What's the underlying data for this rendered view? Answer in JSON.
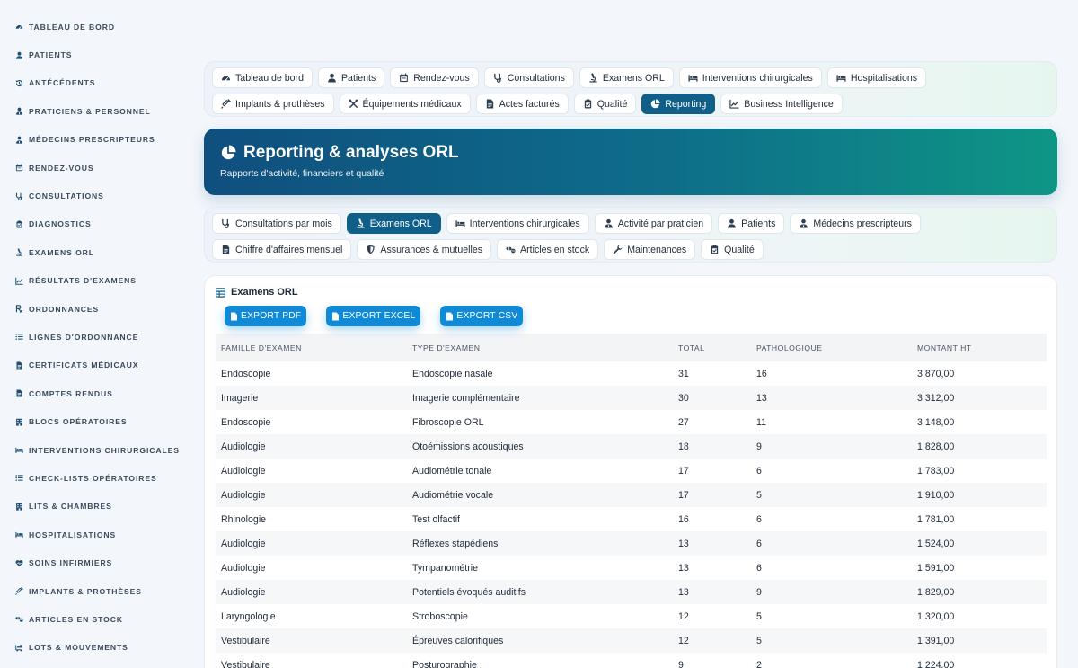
{
  "sidebar": {
    "items": [
      {
        "label": "Tableau de bord",
        "icon": "dashboard-icon"
      },
      {
        "label": "Patients",
        "icon": "user-icon"
      },
      {
        "label": "Antécédents",
        "icon": "history-icon"
      },
      {
        "label": "Praticiens & personnel",
        "icon": "doctor-icon"
      },
      {
        "label": "Médecins prescripteurs",
        "icon": "doctor-icon"
      },
      {
        "label": "Rendez-vous",
        "icon": "calendar-icon"
      },
      {
        "label": "Consultations",
        "icon": "stethoscope-icon"
      },
      {
        "label": "Diagnostics",
        "icon": "clipboard-icon"
      },
      {
        "label": "Examens ORL",
        "icon": "microscope-icon"
      },
      {
        "label": "Résultats d'examens",
        "icon": "chart-line-icon"
      },
      {
        "label": "Ordonnances",
        "icon": "prescription-icon"
      },
      {
        "label": "Lignes d'ordonnance",
        "icon": "list-icon"
      },
      {
        "label": "Certificats médicaux",
        "icon": "file-icon"
      },
      {
        "label": "Comptes rendus",
        "icon": "file-icon"
      },
      {
        "label": "Blocs opératoires",
        "icon": "building-icon"
      },
      {
        "label": "Interventions chirurgicales",
        "icon": "bed-icon"
      },
      {
        "label": "Check-lists opératoires",
        "icon": "list-icon"
      },
      {
        "label": "Lits & chambres",
        "icon": "building-icon"
      },
      {
        "label": "Hospitalisations",
        "icon": "bed-icon"
      },
      {
        "label": "Soins infirmiers",
        "icon": "heart-icon"
      },
      {
        "label": "Implants & prothèses",
        "icon": "syringe-icon"
      },
      {
        "label": "Articles en stock",
        "icon": "pills-icon"
      },
      {
        "label": "Lots & mouvements",
        "icon": "truck-icon"
      },
      {
        "label": "Équipements médicaux",
        "icon": "tools-icon"
      }
    ]
  },
  "top_nav": {
    "items": [
      {
        "label": "Tableau de bord",
        "icon": "dashboard-icon",
        "active": false
      },
      {
        "label": "Patients",
        "icon": "user-icon",
        "active": false
      },
      {
        "label": "Rendez-vous",
        "icon": "calendar-icon",
        "active": false
      },
      {
        "label": "Consultations",
        "icon": "stethoscope-icon",
        "active": false
      },
      {
        "label": "Examens ORL",
        "icon": "microscope-icon",
        "active": false
      },
      {
        "label": "Interventions chirurgicales",
        "icon": "bed-icon",
        "active": false
      },
      {
        "label": "Hospitalisations",
        "icon": "bed-icon",
        "active": false
      },
      {
        "label": "Implants & prothèses",
        "icon": "syringe-icon",
        "active": false
      },
      {
        "label": "Équipements médicaux",
        "icon": "tools-icon",
        "active": false
      },
      {
        "label": "Actes facturés",
        "icon": "file-icon",
        "active": false
      },
      {
        "label": "Qualité",
        "icon": "clipboard-icon",
        "active": false
      },
      {
        "label": "Reporting",
        "icon": "pie-chart-icon",
        "active": true
      },
      {
        "label": "Business Intelligence",
        "icon": "chart-line-icon",
        "active": false
      }
    ]
  },
  "hero": {
    "title": "Reporting & analyses ORL",
    "subtitle": "Rapports d'activité, financiers et qualité",
    "icon": "pie-chart-icon"
  },
  "sub_nav": {
    "items": [
      {
        "label": "Consultations par mois",
        "icon": "stethoscope-icon",
        "active": false
      },
      {
        "label": "Examens ORL",
        "icon": "microscope-icon",
        "active": true
      },
      {
        "label": "Interventions chirurgicales",
        "icon": "bed-icon",
        "active": false
      },
      {
        "label": "Activité par praticien",
        "icon": "doctor-icon",
        "active": false
      },
      {
        "label": "Patients",
        "icon": "user-icon",
        "active": false
      },
      {
        "label": "Médecins prescripteurs",
        "icon": "doctor-icon",
        "active": false
      },
      {
        "label": "Chiffre d'affaires mensuel",
        "icon": "file-icon",
        "active": false
      },
      {
        "label": "Assurances & mutuelles",
        "icon": "shield-icon",
        "active": false
      },
      {
        "label": "Articles en stock",
        "icon": "pills-icon",
        "active": false
      },
      {
        "label": "Maintenances",
        "icon": "wrench-icon",
        "active": false
      },
      {
        "label": "Qualité",
        "icon": "clipboard-icon",
        "active": false
      }
    ]
  },
  "card": {
    "title": "Examens ORL",
    "export_pdf": "EXPORT PDF",
    "export_excel": "EXPORT EXCEL",
    "export_csv": "EXPORT CSV",
    "columns": [
      "FAMILLE D'EXAMEN",
      "TYPE D'EXAMEN",
      "TOTAL",
      "PATHOLOGIQUE",
      "MONTANT HT"
    ],
    "rows": [
      [
        "Endoscopie",
        "Endoscopie nasale",
        "31",
        "16",
        "3 870,00"
      ],
      [
        "Imagerie",
        "Imagerie complémentaire",
        "30",
        "13",
        "3 312,00"
      ],
      [
        "Endoscopie",
        "Fibroscopie ORL",
        "27",
        "11",
        "3 148,00"
      ],
      [
        "Audiologie",
        "Otoémissions acoustiques",
        "18",
        "9",
        "1 828,00"
      ],
      [
        "Audiologie",
        "Audiométrie tonale",
        "17",
        "6",
        "1 783,00"
      ],
      [
        "Audiologie",
        "Audiométrie vocale",
        "17",
        "5",
        "1 910,00"
      ],
      [
        "Rhinologie",
        "Test olfactif",
        "16",
        "6",
        "1 781,00"
      ],
      [
        "Audiologie",
        "Réflexes stapédiens",
        "13",
        "6",
        "1 524,00"
      ],
      [
        "Audiologie",
        "Tympanométrie",
        "13",
        "6",
        "1 591,00"
      ],
      [
        "Audiologie",
        "Potentiels évoqués auditifs",
        "13",
        "9",
        "1 829,00"
      ],
      [
        "Laryngologie",
        "Stroboscopie",
        "12",
        "5",
        "1 320,00"
      ],
      [
        "Vestibulaire",
        "Épreuves calorifiques",
        "12",
        "5",
        "1 391,00"
      ],
      [
        "Vestibulaire",
        "Posturographie",
        "9",
        "2",
        "1 224,00"
      ]
    ]
  },
  "colors": {
    "accent": "#0f5f89",
    "button": "#1089d6",
    "hero_start": "#0f4f7f",
    "hero_end": "#0e9685"
  }
}
